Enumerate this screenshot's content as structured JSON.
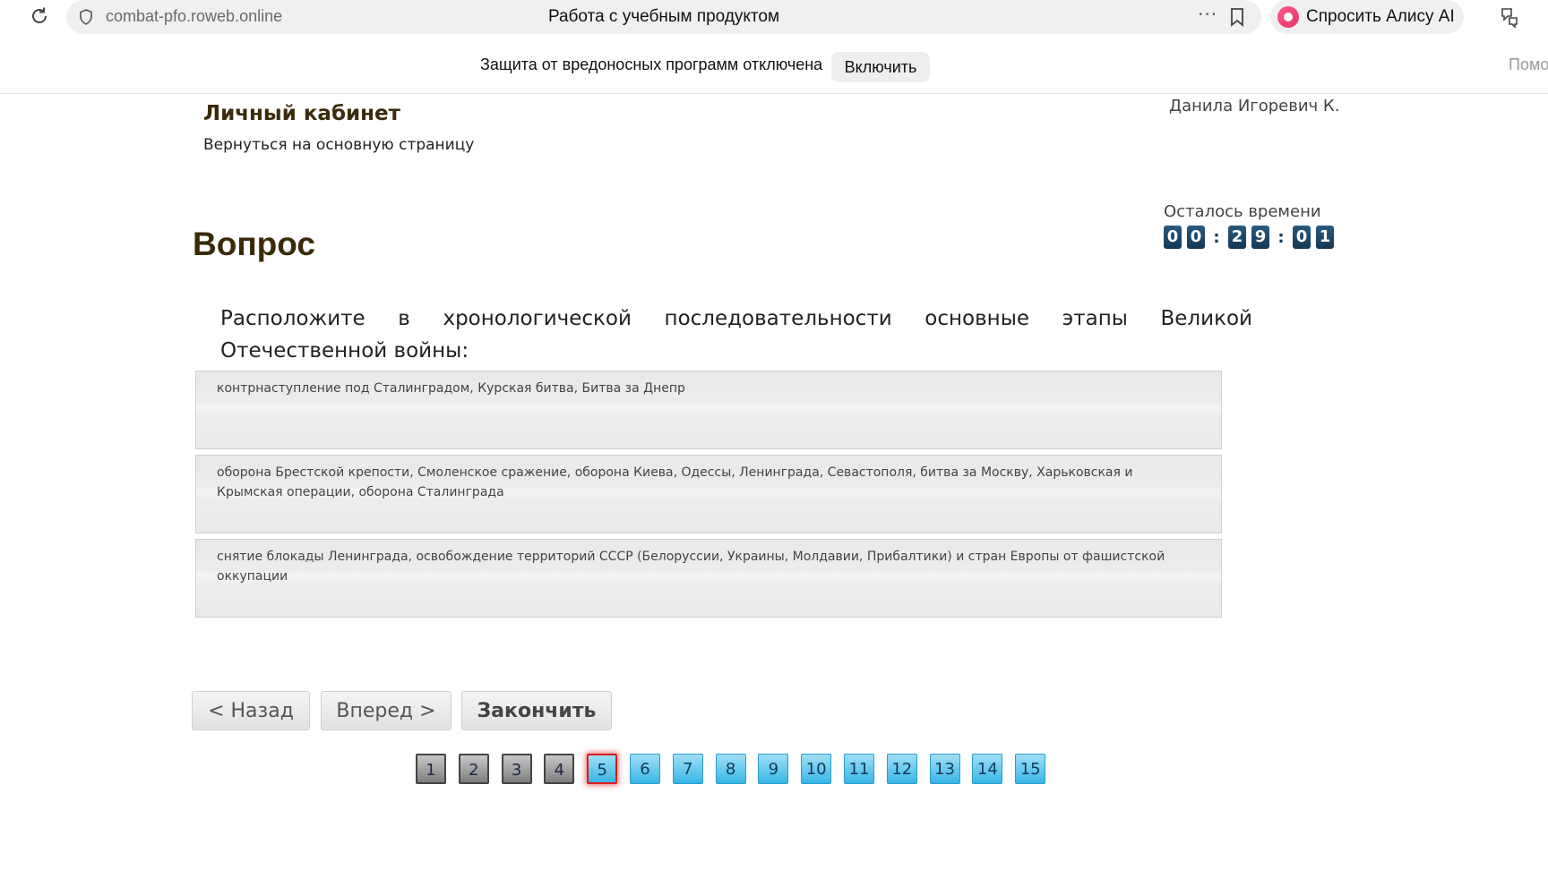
{
  "browser": {
    "url": "combat-pfo.roweb.online",
    "tab_title": "Работа с учебным продуктом",
    "more": "···",
    "alice_label": "Спросить Алису AI"
  },
  "notice": {
    "text": "Защита от вредоносных программ отключена",
    "enable_label": "Включить",
    "help_label": "Помо"
  },
  "header": {
    "title": "Личный кабинет",
    "back_link": "Вернуться на основную страницу",
    "user_name": "Данила Игоревич К."
  },
  "timer": {
    "label": "Осталось времени",
    "digits": [
      "0",
      "0",
      ":",
      "2",
      "9",
      ":",
      "0",
      "1"
    ]
  },
  "question": {
    "heading": "Вопрос",
    "text": "Расположите в хронологической последовательности основные этапы Великой Отечественной войны:",
    "answers": [
      "контрнаступление под Сталинградом, Курская битва, Битва за Днепр",
      "оборона Брестской крепости, Смоленское сражение, оборона Киева, Одессы, Ленинграда, Севастополя, битва за Москву, Харьковская и Крымская операции, оборона Сталинграда",
      "снятие блокады Ленинграда, освобождение территорий СССР (Белоруссии, Украины, Молдавии, Прибалтики) и стран Европы от фашистской оккупации"
    ]
  },
  "navigation": {
    "prev_label": "< Назад",
    "next_label": "Вперед >",
    "finish_label": "Закончить"
  },
  "pager": {
    "pages": [
      "1",
      "2",
      "3",
      "4",
      "5",
      "6",
      "7",
      "8",
      "9",
      "10",
      "11",
      "12",
      "13",
      "14",
      "15"
    ],
    "current": "5",
    "answered": [
      "1",
      "2",
      "3",
      "4"
    ]
  },
  "colors": {
    "timer_digit_bg": "#1d4668",
    "page_todo": "#38b5e6",
    "page_current_border": "#e01b1b",
    "heading_brown": "#3a2a0a"
  }
}
